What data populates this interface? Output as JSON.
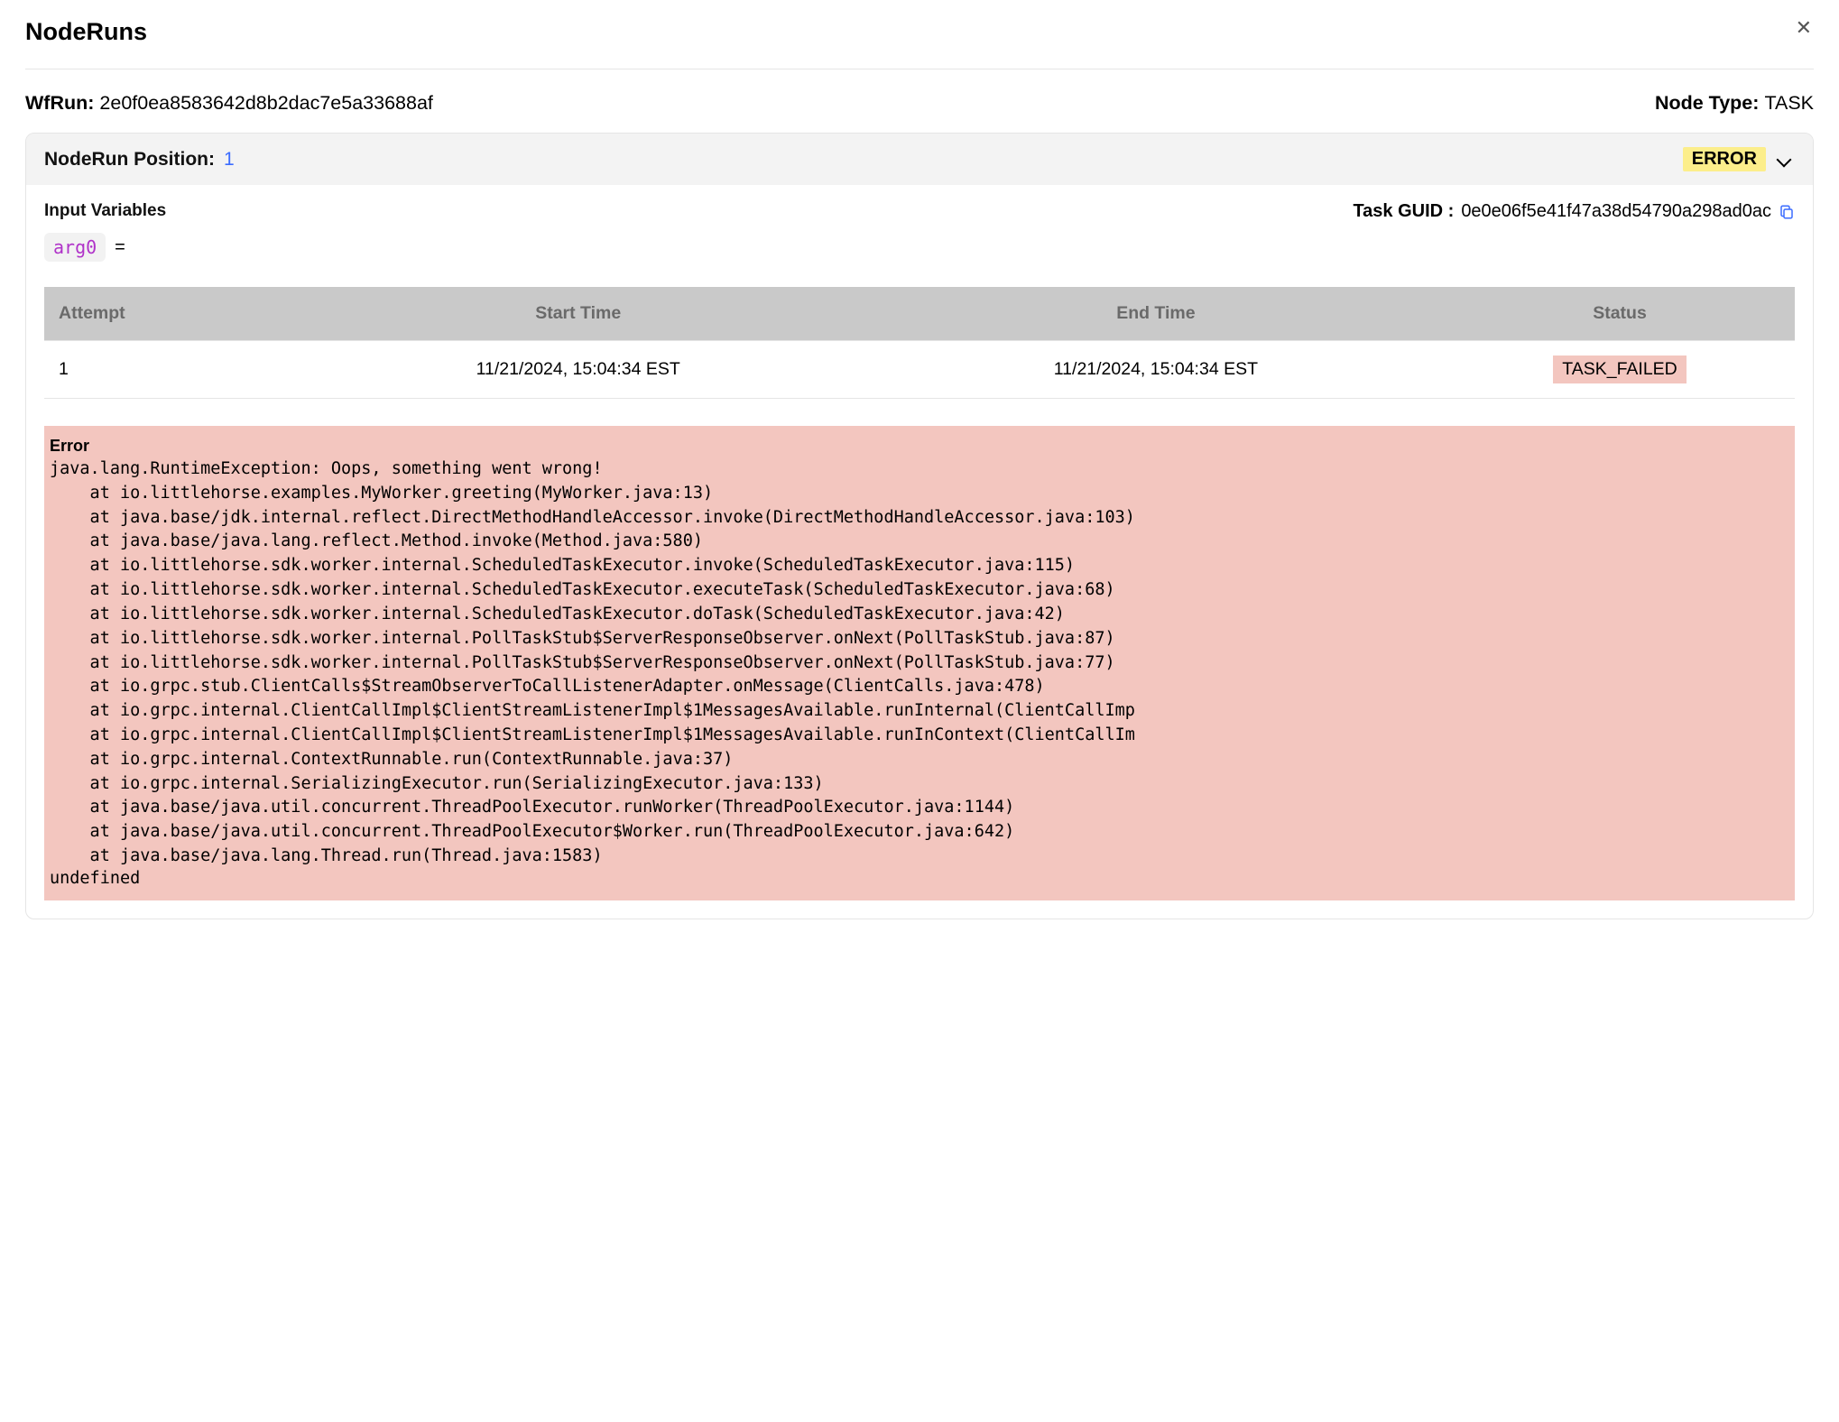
{
  "page": {
    "title": "NodeRuns"
  },
  "wfrun": {
    "label": "WfRun",
    "id": "2e0f0ea8583642d8b2dac7e5a33688af"
  },
  "nodetype": {
    "label": "Node Type",
    "value": "TASK"
  },
  "accordion": {
    "position_label": "NodeRun Position:",
    "position_value": "1",
    "status_badge": "ERROR"
  },
  "inputvars": {
    "label": "Input Variables",
    "arg_name": "arg0",
    "equals": "="
  },
  "taskguid": {
    "label": "Task GUID :",
    "value": "0e0e06f5e41f47a38d54790a298ad0ac"
  },
  "table": {
    "headers": [
      "Attempt",
      "Start Time",
      "End Time",
      "Status"
    ],
    "rows": [
      {
        "attempt": "1",
        "start": "11/21/2024, 15:04:34 EST",
        "end": "11/21/2024, 15:04:34 EST",
        "status": "TASK_FAILED"
      }
    ]
  },
  "error": {
    "title": "Error",
    "trace": "java.lang.RuntimeException: Oops, something went wrong!\n    at io.littlehorse.examples.MyWorker.greeting(MyWorker.java:13)\n    at java.base/jdk.internal.reflect.DirectMethodHandleAccessor.invoke(DirectMethodHandleAccessor.java:103)\n    at java.base/java.lang.reflect.Method.invoke(Method.java:580)\n    at io.littlehorse.sdk.worker.internal.ScheduledTaskExecutor.invoke(ScheduledTaskExecutor.java:115)\n    at io.littlehorse.sdk.worker.internal.ScheduledTaskExecutor.executeTask(ScheduledTaskExecutor.java:68)\n    at io.littlehorse.sdk.worker.internal.ScheduledTaskExecutor.doTask(ScheduledTaskExecutor.java:42)\n    at io.littlehorse.sdk.worker.internal.PollTaskStub$ServerResponseObserver.onNext(PollTaskStub.java:87)\n    at io.littlehorse.sdk.worker.internal.PollTaskStub$ServerResponseObserver.onNext(PollTaskStub.java:77)\n    at io.grpc.stub.ClientCalls$StreamObserverToCallListenerAdapter.onMessage(ClientCalls.java:478)\n    at io.grpc.internal.ClientCallImpl$ClientStreamListenerImpl$1MessagesAvailable.runInternal(ClientCallImp\n    at io.grpc.internal.ClientCallImpl$ClientStreamListenerImpl$1MessagesAvailable.runInContext(ClientCallIm\n    at io.grpc.internal.ContextRunnable.run(ContextRunnable.java:37)\n    at io.grpc.internal.SerializingExecutor.run(SerializingExecutor.java:133)\n    at java.base/java.util.concurrent.ThreadPoolExecutor.runWorker(ThreadPoolExecutor.java:1144)\n    at java.base/java.util.concurrent.ThreadPoolExecutor$Worker.run(ThreadPoolExecutor.java:642)\n    at java.base/java.lang.Thread.run(Thread.java:1583)",
    "undefined": "undefined"
  }
}
